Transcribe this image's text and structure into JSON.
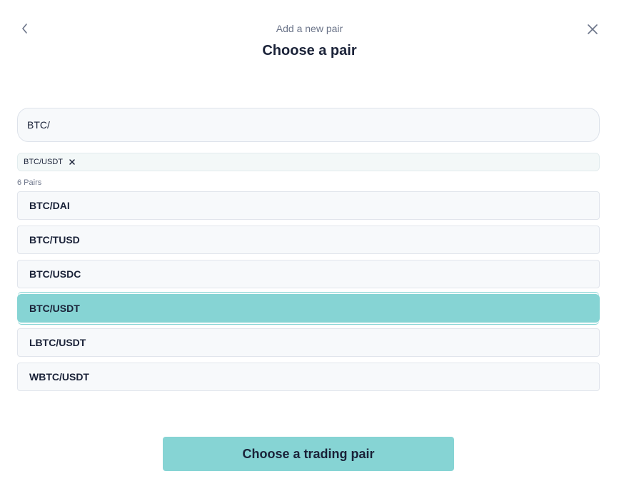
{
  "header": {
    "subtitle": "Add a new pair",
    "title": "Choose a pair",
    "back_icon": "chevron-left-icon",
    "close_icon": "close-icon"
  },
  "search": {
    "value": "BTC/"
  },
  "selected_chips": [
    {
      "label": "BTC/USDT",
      "remove_icon": "close-icon"
    }
  ],
  "results": {
    "count_label": "6 Pairs",
    "items": [
      {
        "label": "BTC/DAI",
        "selected": false
      },
      {
        "label": "BTC/TUSD",
        "selected": false
      },
      {
        "label": "BTC/USDC",
        "selected": false
      },
      {
        "label": "BTC/USDT",
        "selected": true
      },
      {
        "label": "LBTC/USDT",
        "selected": false
      },
      {
        "label": "WBTC/USDT",
        "selected": false
      }
    ]
  },
  "footer": {
    "cta_label": "Choose a trading pair"
  },
  "colors": {
    "accent": "#86d4d4",
    "text": "#1a2238",
    "muted": "#6b7489"
  }
}
